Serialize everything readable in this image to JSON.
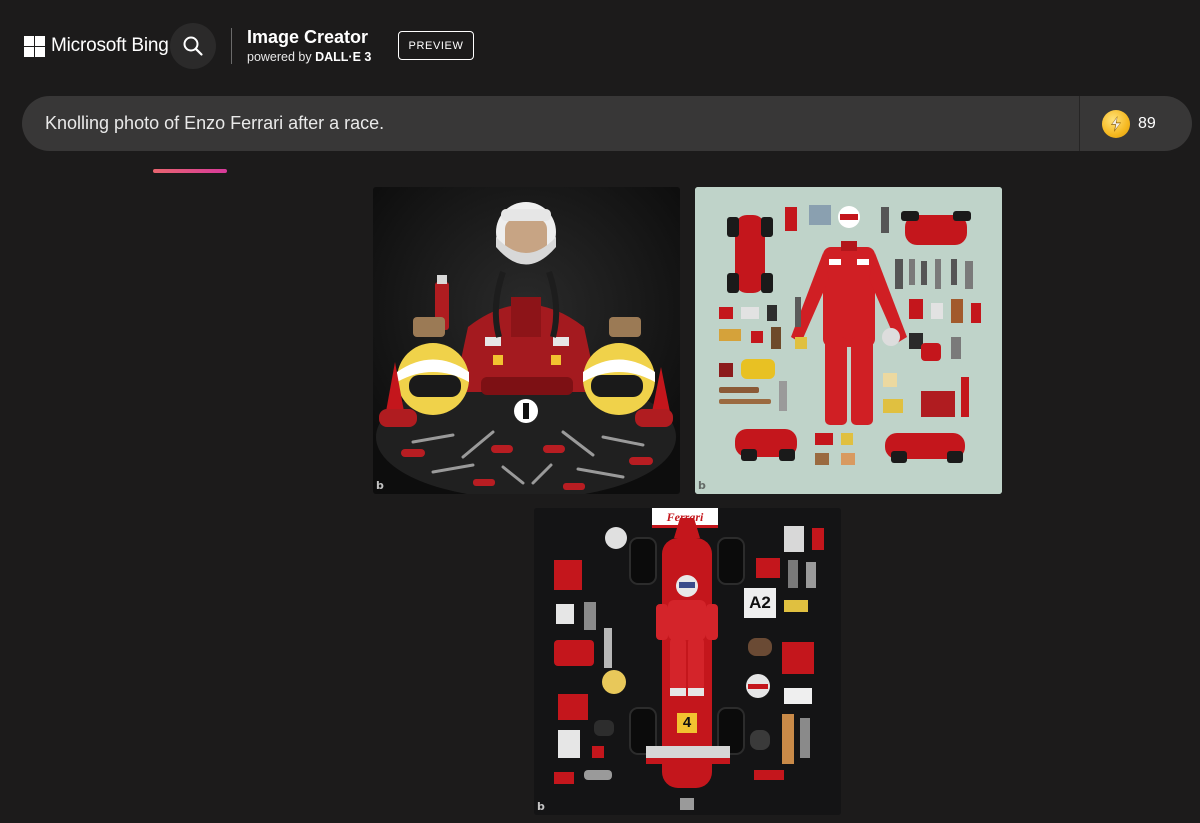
{
  "header": {
    "brand_name": "Microsoft Bing",
    "product_title": "Image Creator",
    "product_sub_prefix": "powered by ",
    "product_sub_model": "DALL·E 3",
    "preview_label": "PREVIEW"
  },
  "prompt": {
    "value": "Knolling photo of Enzo Ferrari after a race.",
    "boosts_count": "89"
  },
  "results": {
    "tiles": [
      {
        "watermark": "b"
      },
      {
        "watermark": "b"
      },
      {
        "watermark": "b",
        "sign_text": "Ferrari",
        "bib_text": "A2",
        "car_number": "4"
      }
    ]
  },
  "colors": {
    "page_bg": "#1c1b1b",
    "prompt_bg": "#383737",
    "accent_start": "#e8656f",
    "accent_end": "#d83a9b",
    "boost_coin": "#f5b820",
    "ferrari_red": "#c4161c"
  }
}
